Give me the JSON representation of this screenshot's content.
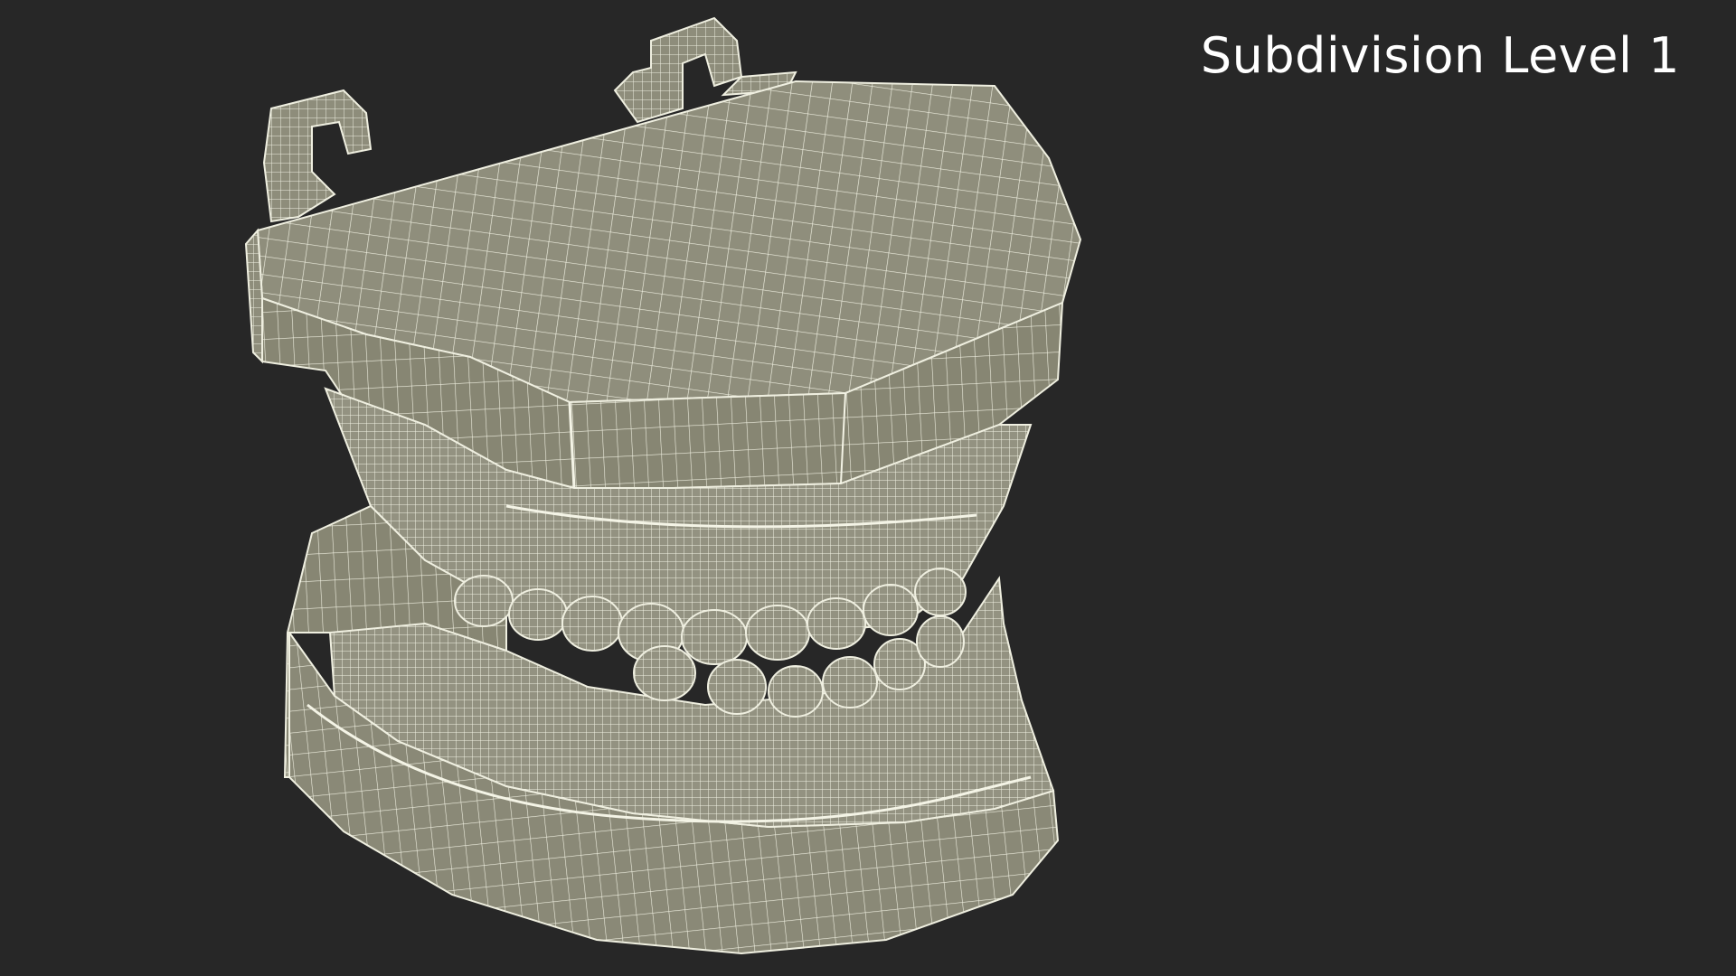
{
  "viewport": {
    "background_color": "#272727",
    "label": "Subdivision Level 1"
  },
  "model": {
    "name": "dental-model-wireframe",
    "surface_color": "#8e8d7b",
    "shadow_color": "#6e6d5e",
    "wire_color": "#eeeedd"
  }
}
